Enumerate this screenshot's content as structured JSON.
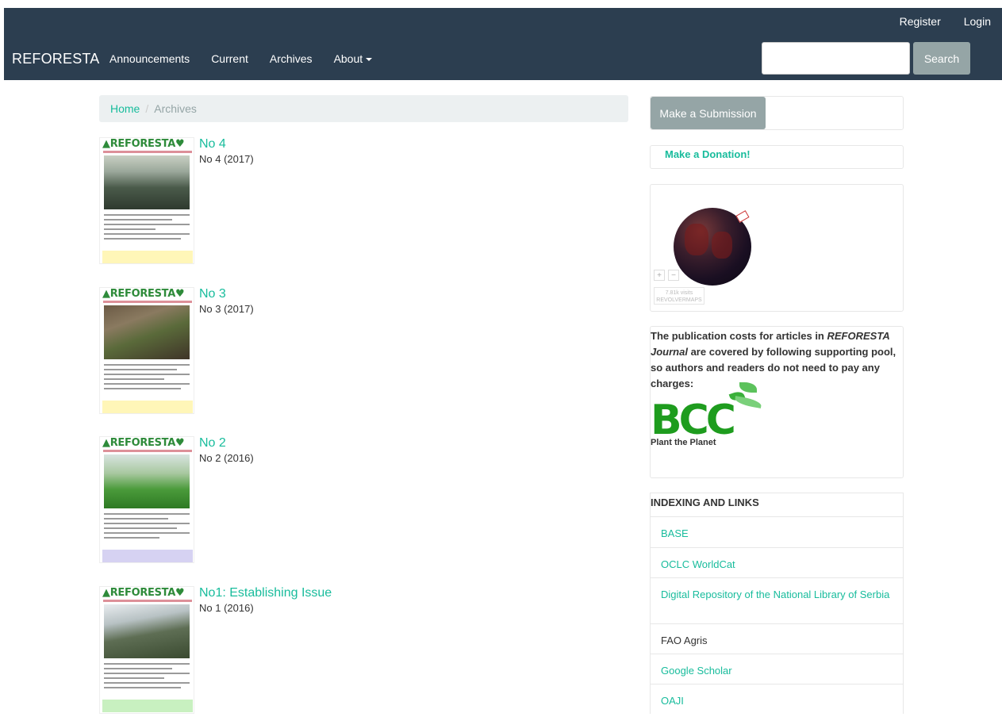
{
  "header": {
    "brand": "REFORESTA",
    "user_nav": [
      "Register",
      "Login"
    ],
    "nav": [
      "Announcements",
      "Current",
      "Archives",
      "About"
    ],
    "search_button": "Search",
    "search_placeholder": ""
  },
  "breadcrumb": {
    "home": "Home",
    "separator": "/",
    "current": "Archives"
  },
  "issues": [
    {
      "title": "No 4",
      "series": "No 4 (2017)",
      "cover_logo": "REFORESTA",
      "band_color": "#fff6b8"
    },
    {
      "title": "No 3",
      "series": "No 3 (2017)",
      "cover_logo": "REFORESTA",
      "band_color": "#fff6b8"
    },
    {
      "title": "No 2",
      "series": "No 2 (2016)",
      "cover_logo": "REFORESTA",
      "band_color": "#d6d2f2"
    },
    {
      "title": "No1: Establishing Issue",
      "series": "No 1 (2016)",
      "cover_logo": "REFORESTA",
      "band_color": "#c8f0c0"
    }
  ],
  "sidebar": {
    "submission": "Make a Submission",
    "donation": "Make a Donation!",
    "map": {
      "zoom_in": "+",
      "zoom_out": "−",
      "visits": "7.81k visits",
      "provider": "REVOLVERMAPS"
    },
    "cost": {
      "text_before": "The publication costs for articles in ",
      "journal": "REFORESTA Journal",
      "text_after": " are covered by following supporting pool, so authors and readers do not need to pay any charges:"
    },
    "sponsor": {
      "logo": "BCC",
      "tagline": "Plant the Planet"
    },
    "indexing": {
      "title": "INDEXING AND LINKS",
      "links": [
        {
          "label": "BASE",
          "is_link": true
        },
        {
          "label": "OCLC WorldCat",
          "is_link": true
        },
        {
          "label": "Digital Repository of the National Library of Serbia",
          "is_link": true
        },
        {
          "label": "FAO Agris",
          "is_link": false
        },
        {
          "label": "Google Scholar",
          "is_link": true
        },
        {
          "label": "OAJI",
          "is_link": true
        }
      ]
    }
  },
  "colors": {
    "header_bg": "#2c3e50",
    "accent": "#18bc9c",
    "button_gray": "#95a5a6",
    "breadcrumb_bg": "#ecf0f1"
  }
}
